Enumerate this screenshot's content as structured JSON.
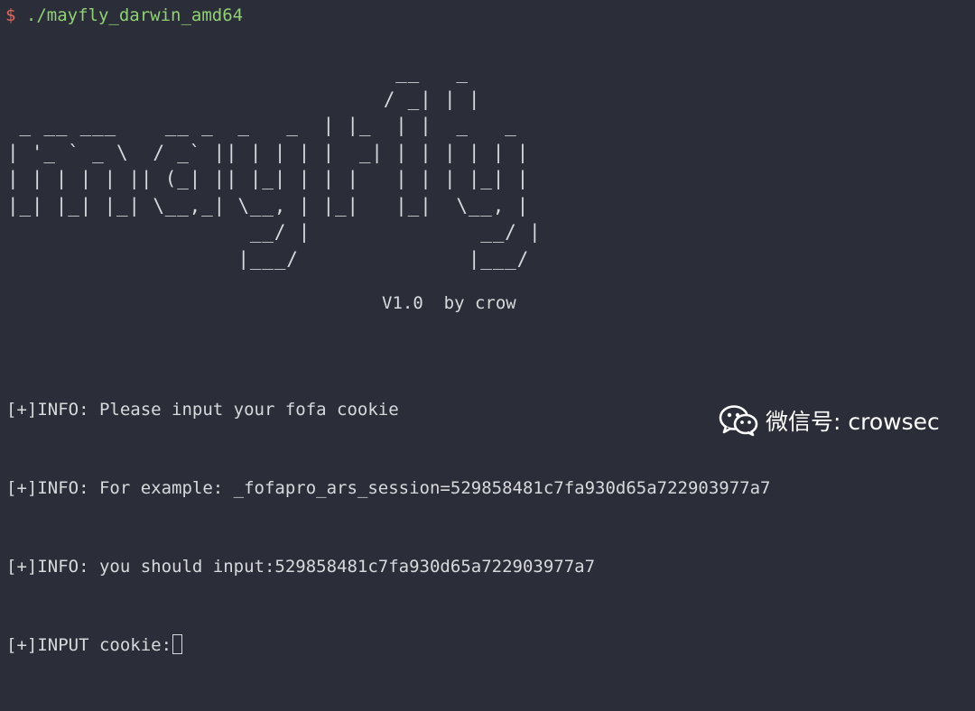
{
  "terminal": {
    "prompt_symbol": "$",
    "command": "./mayfly_darwin_amd64",
    "banner_lines": [
      "                                __   _",
      "                               / _| | |",
      " _ __ ___    __ _  _   _  | |_  | |  _   _",
      "| '_ ` _ \\  / _` || | | | |  _| | | | | | |",
      "| | | | | || (_| || |_| | | |   | | | |_| |",
      "|_| |_| |_| \\__,_| \\__, | |_|   |_|  \\__, |",
      "                    __/ |              __/ |",
      "                   |___/              |___/"
    ],
    "version": "V1.0  by crow",
    "log_lines": [
      "[+]INFO: Please input your fofa cookie",
      "[+]INFO: For example: _fofapro_ars_session=529858481c7fa930d65a722903977a7",
      "[+]INFO: you should input:529858481c7fa930d65a722903977a7",
      "[+]INPUT cookie:"
    ]
  },
  "watermark": {
    "text": "微信号: crowsec",
    "icon": "wechat-icon"
  },
  "colors": {
    "background": "#2b2e38",
    "text": "#d8d9dc",
    "prompt_symbol": "#e0685e",
    "command": "#8fd174"
  }
}
